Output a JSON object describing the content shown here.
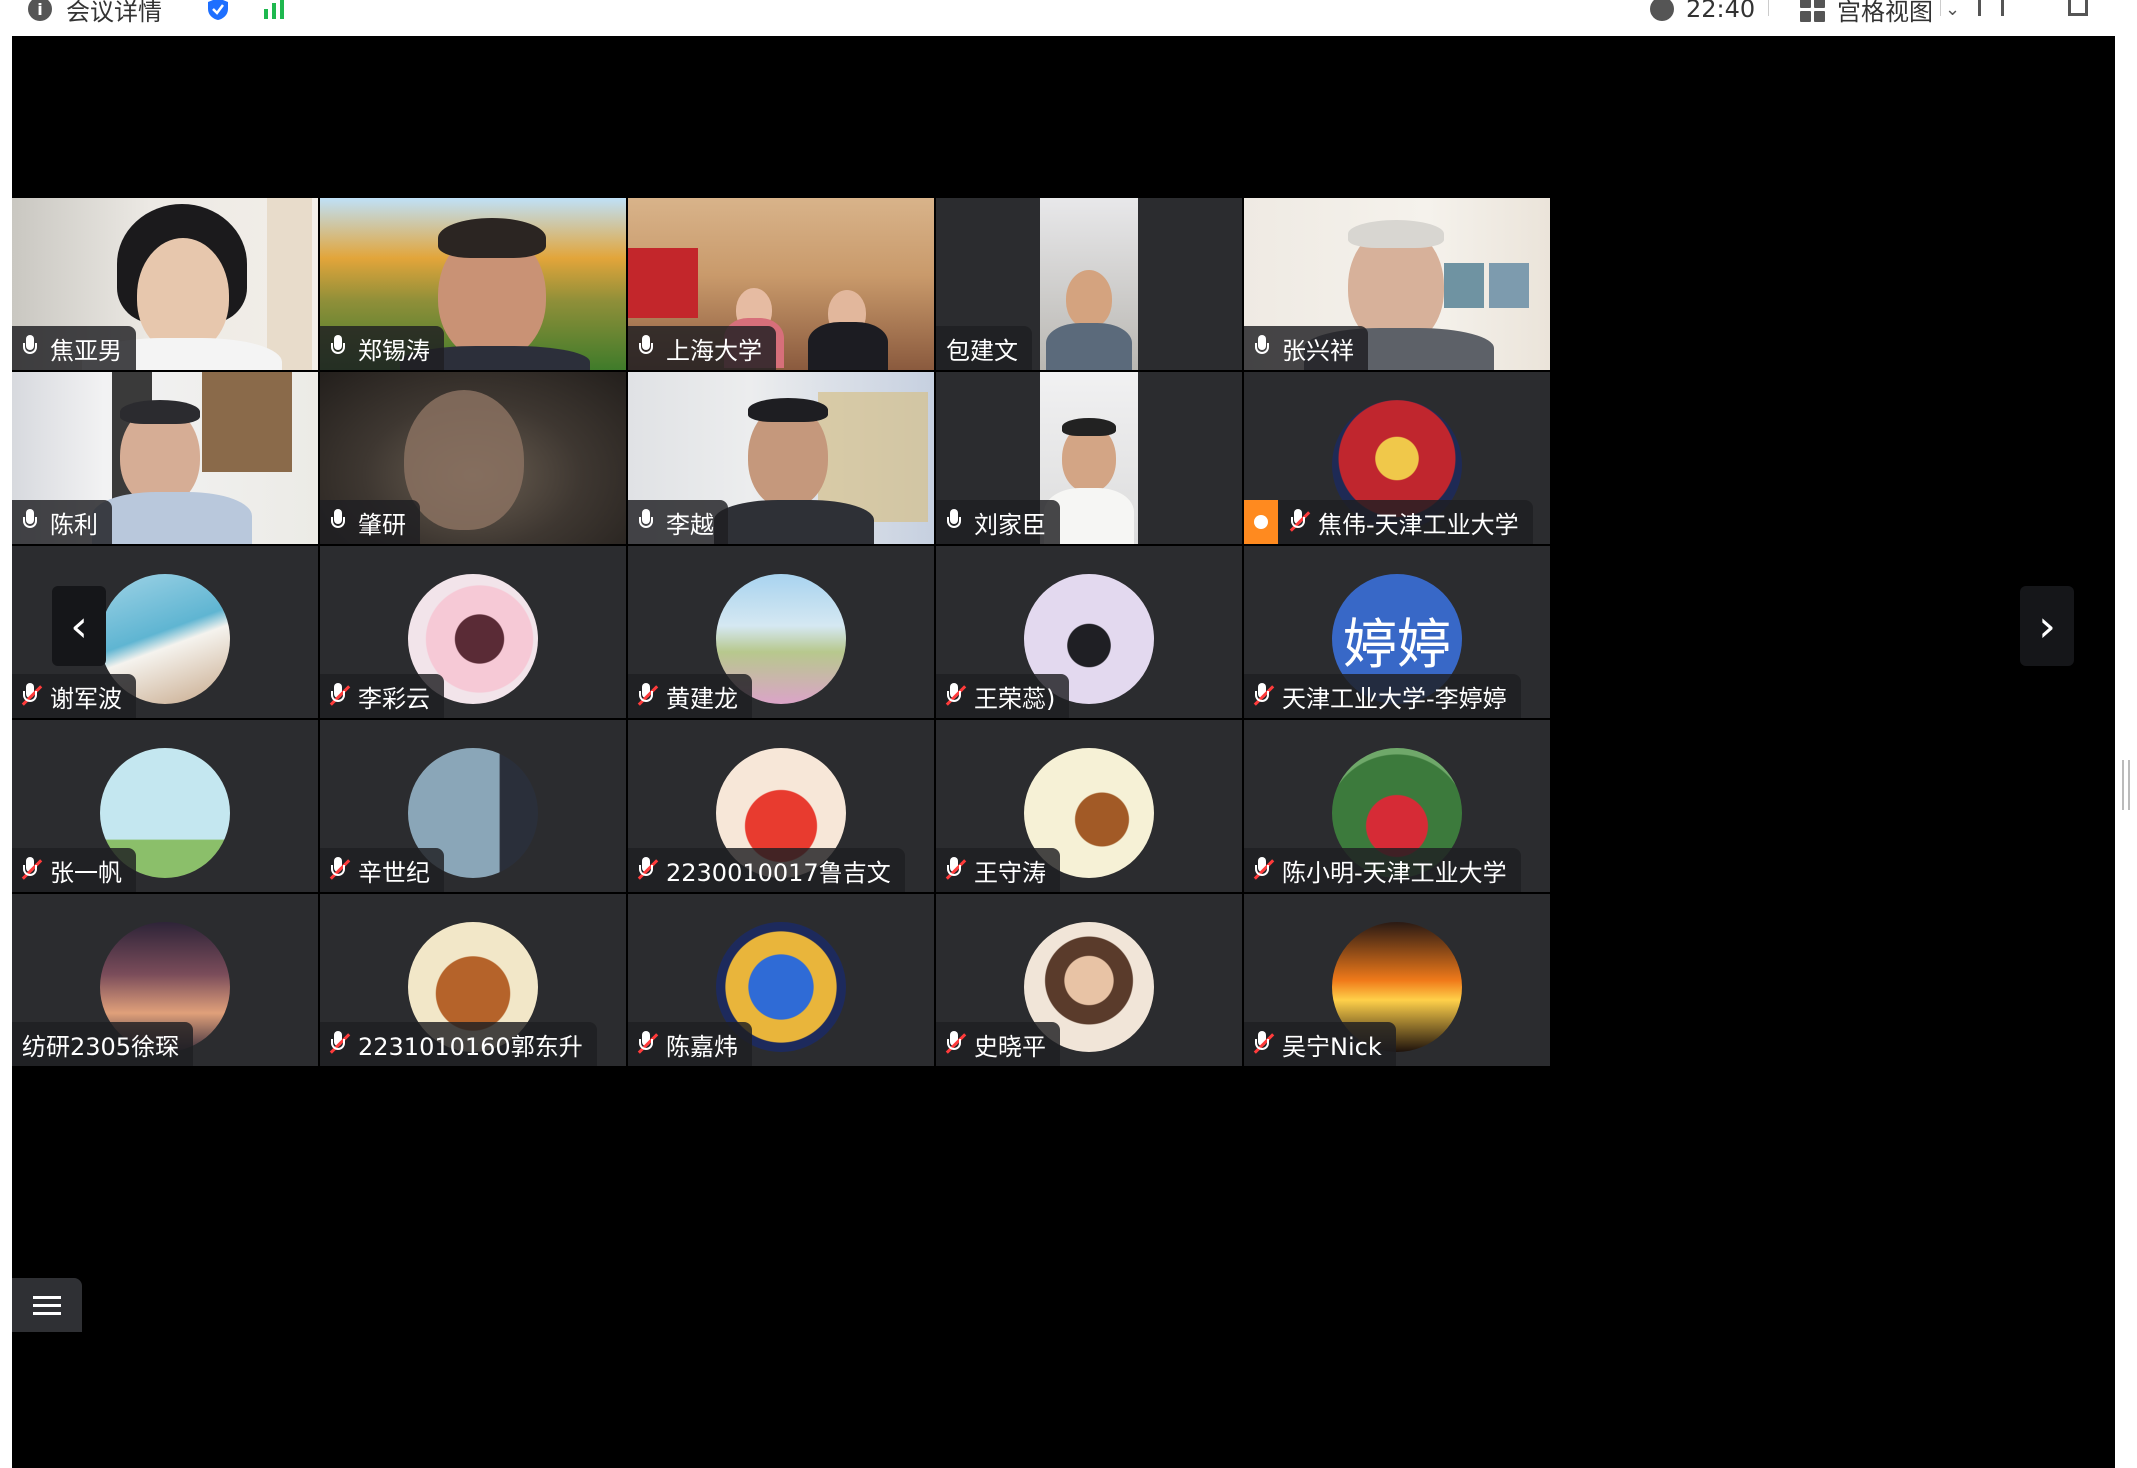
{
  "topbar": {
    "meeting_info_label": "会议详情",
    "time": "22:40",
    "view_mode_label": "宫格视图",
    "chevron_label": "⌄",
    "fullscreen_label": "",
    "window_label": ""
  },
  "grid": {
    "columns": 5,
    "rows": 5,
    "tiles": [
      {
        "name": "焦亚男",
        "mic": "on",
        "kind": "video",
        "video_style": "woman-room"
      },
      {
        "name": "郑锡涛",
        "mic": "on",
        "kind": "video",
        "video_style": "man-park"
      },
      {
        "name": "上海大学",
        "mic": "on",
        "kind": "video",
        "video_style": "meeting-room"
      },
      {
        "name": "包建文",
        "mic": "none",
        "kind": "video",
        "video_style": "portrait-phone"
      },
      {
        "name": "张兴祥",
        "mic": "on",
        "kind": "video",
        "video_style": "man-home"
      },
      {
        "name": "陈利",
        "mic": "on",
        "kind": "video",
        "video_style": "man-office",
        "active": true
      },
      {
        "name": "肇研",
        "mic": "on",
        "kind": "video",
        "video_style": "dark-room"
      },
      {
        "name": "李越",
        "mic": "on",
        "kind": "video",
        "video_style": "man-map"
      },
      {
        "name": "刘家臣",
        "mic": "on",
        "kind": "video",
        "video_style": "portrait-phone-2"
      },
      {
        "name": "焦伟-天津工业大学",
        "mic": "muted",
        "kind": "avatar",
        "avatar": "ironman-icon",
        "host": true
      },
      {
        "name": "谢军波",
        "mic": "muted",
        "kind": "avatar",
        "avatar": "beach-icon"
      },
      {
        "name": "李彩云",
        "mic": "muted",
        "kind": "avatar",
        "avatar": "anime-girl-icon"
      },
      {
        "name": "黄建龙",
        "mic": "muted",
        "kind": "avatar",
        "avatar": "flower-field-icon"
      },
      {
        "name": "王荣蕊)",
        "mic": "muted",
        "kind": "avatar",
        "avatar": "girl-illustration-icon"
      },
      {
        "name": "天津工业大学-李婷婷",
        "mic": "muted",
        "kind": "avatar-text",
        "avatar_text": "婷婷"
      },
      {
        "name": "张一帆",
        "mic": "muted",
        "kind": "avatar",
        "avatar": "cartoon-figure-icon"
      },
      {
        "name": "辛世纪",
        "mic": "muted",
        "kind": "avatar",
        "avatar": "silhouette-icon"
      },
      {
        "name": "2230010017鲁吉文",
        "mic": "muted",
        "kind": "avatar",
        "avatar": "party-100-icon"
      },
      {
        "name": "王守涛",
        "mic": "muted",
        "kind": "avatar",
        "avatar": "cartoon-boy-icon"
      },
      {
        "name": "陈小明-天津工业大学",
        "mic": "muted",
        "kind": "avatar",
        "avatar": "child-photo-icon"
      },
      {
        "name": "纺研2305徐琛",
        "mic": "none",
        "kind": "avatar",
        "avatar": "moon-sky-icon"
      },
      {
        "name": "2231010160郭东升",
        "mic": "muted",
        "kind": "avatar",
        "avatar": "cartoon-warrior-icon"
      },
      {
        "name": "陈嘉炜",
        "mic": "muted",
        "kind": "avatar",
        "avatar": "robot-icon"
      },
      {
        "name": "史晓平",
        "mic": "muted",
        "kind": "avatar",
        "avatar": "woman-photo-icon"
      },
      {
        "name": "吴宁Nick",
        "mic": "muted",
        "kind": "avatar",
        "avatar": "sunset-eagle-icon"
      }
    ]
  },
  "nav": {
    "prev_symbol": "‹",
    "next_symbol": "›"
  },
  "colors": {
    "stage_bg": "#000000",
    "tile_bg": "#2b2c2f",
    "active_speaker": "#1fc46b",
    "muted": "#ff3b3b",
    "host_badge": "#ff8a1f",
    "text_avatar_bg": "#3868c7"
  }
}
